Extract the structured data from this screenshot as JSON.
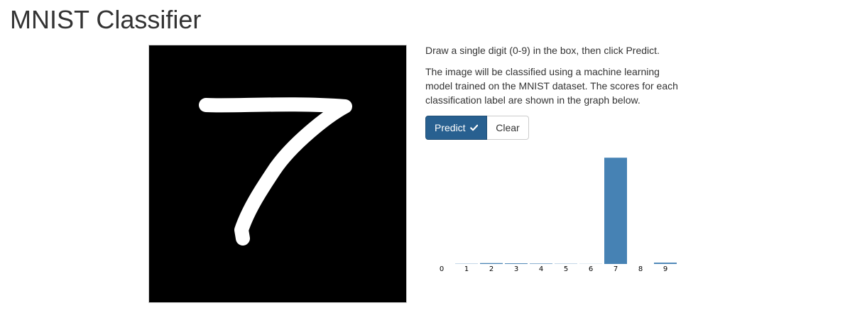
{
  "header": {
    "title": "MNIST Classifier"
  },
  "instructions": {
    "line1": "Draw a single digit (0-9) in the box, then click Predict.",
    "line2": "The image will be classified using a machine learning model trained on the MNIST dataset. The scores for each classification label are shown in the graph below."
  },
  "buttons": {
    "predict_label": "Predict",
    "predict_icon": "check-icon",
    "clear_label": "Clear"
  },
  "canvas": {
    "background": "#000000",
    "stroke_color": "#ffffff",
    "drawn_digit": "7"
  },
  "colors": {
    "primary": "#286090",
    "bar": "#4682b4"
  },
  "chart_data": {
    "type": "bar",
    "categories": [
      "0",
      "1",
      "2",
      "3",
      "4",
      "5",
      "6",
      "7",
      "8",
      "9"
    ],
    "values": [
      0.0,
      0.002,
      0.008,
      0.006,
      0.004,
      0.002,
      0.001,
      0.96,
      0.0,
      0.012
    ],
    "title": "",
    "xlabel": "",
    "ylabel": "",
    "ylim": [
      0,
      1
    ],
    "grid": false,
    "legend": "none"
  }
}
